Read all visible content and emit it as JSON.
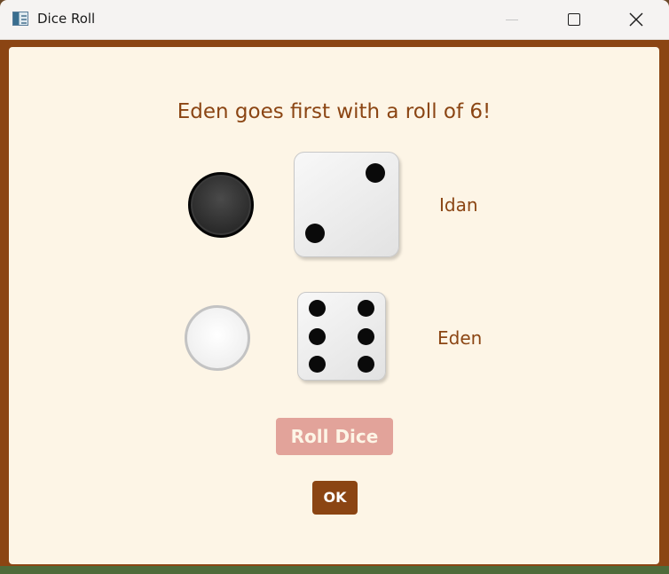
{
  "window": {
    "title": "Dice Roll",
    "app_icon": "window-app-icon"
  },
  "controls": {
    "minimize_icon": "minimize-icon",
    "maximize_icon": "maximize-icon",
    "close_icon": "close-icon"
  },
  "dialog": {
    "headline": "Eden goes first with a roll of 6!",
    "players": [
      {
        "name": "Idan",
        "checker": "dark",
        "die_value": 2
      },
      {
        "name": "Eden",
        "checker": "light",
        "die_value": 6
      }
    ],
    "roll_button_label": "Roll Dice",
    "roll_button_enabled": false,
    "ok_button_label": "OK"
  },
  "colors": {
    "accent": "#8b4513",
    "background": "#fdf5e6",
    "disabled_button": "#e2a39a"
  }
}
